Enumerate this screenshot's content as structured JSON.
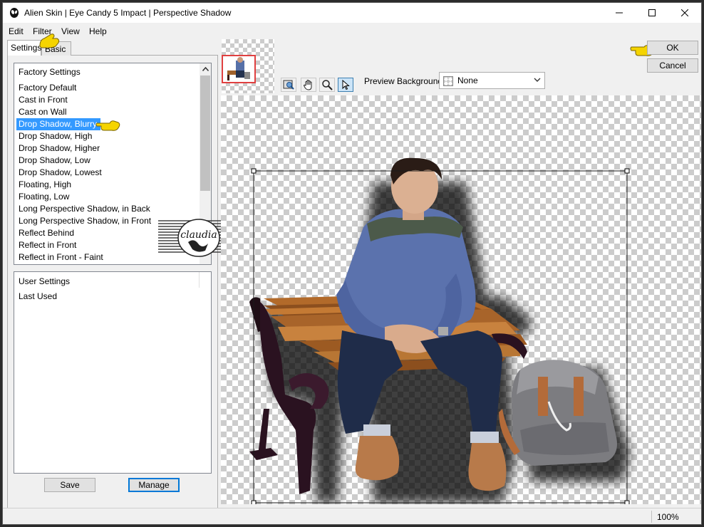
{
  "window": {
    "title": "Alien Skin | Eye Candy 5 Impact | Perspective Shadow"
  },
  "menu": {
    "items": [
      "Edit",
      "Filter",
      "View",
      "Help"
    ]
  },
  "tabs": {
    "settings": "Settings",
    "basic": "Basic"
  },
  "factory_settings": {
    "header": "Factory Settings",
    "selected": "Drop Shadow, Blurry",
    "items": [
      "Factory Default",
      "Cast in Front",
      "Cast on Wall",
      "Drop Shadow, Blurry",
      "Drop Shadow, High",
      "Drop Shadow, Higher",
      "Drop Shadow, Low",
      "Drop Shadow, Lowest",
      "Floating, High",
      "Floating, Low",
      "Long Perspective Shadow, in Back",
      "Long Perspective Shadow, in Front",
      "Reflect Behind",
      "Reflect in Front",
      "Reflect in Front - Faint"
    ]
  },
  "user_settings": {
    "header": "User Settings",
    "items": [
      "Last Used"
    ]
  },
  "buttons": {
    "save": "Save",
    "manage": "Manage",
    "ok": "OK",
    "cancel": "Cancel"
  },
  "watermark": {
    "text": "claudia"
  },
  "toolbar": {
    "tools": [
      "navigator-tool-icon",
      "hand-tool-icon",
      "zoom-tool-icon",
      "pointer-tool-icon"
    ],
    "preview_background_label": "Preview Background:",
    "preview_background_value": "None"
  },
  "status": {
    "zoom": "100%"
  },
  "colors": {
    "selection": "#3399ff",
    "accent_border": "#0078d7",
    "callout_hand": "#f5d400"
  }
}
